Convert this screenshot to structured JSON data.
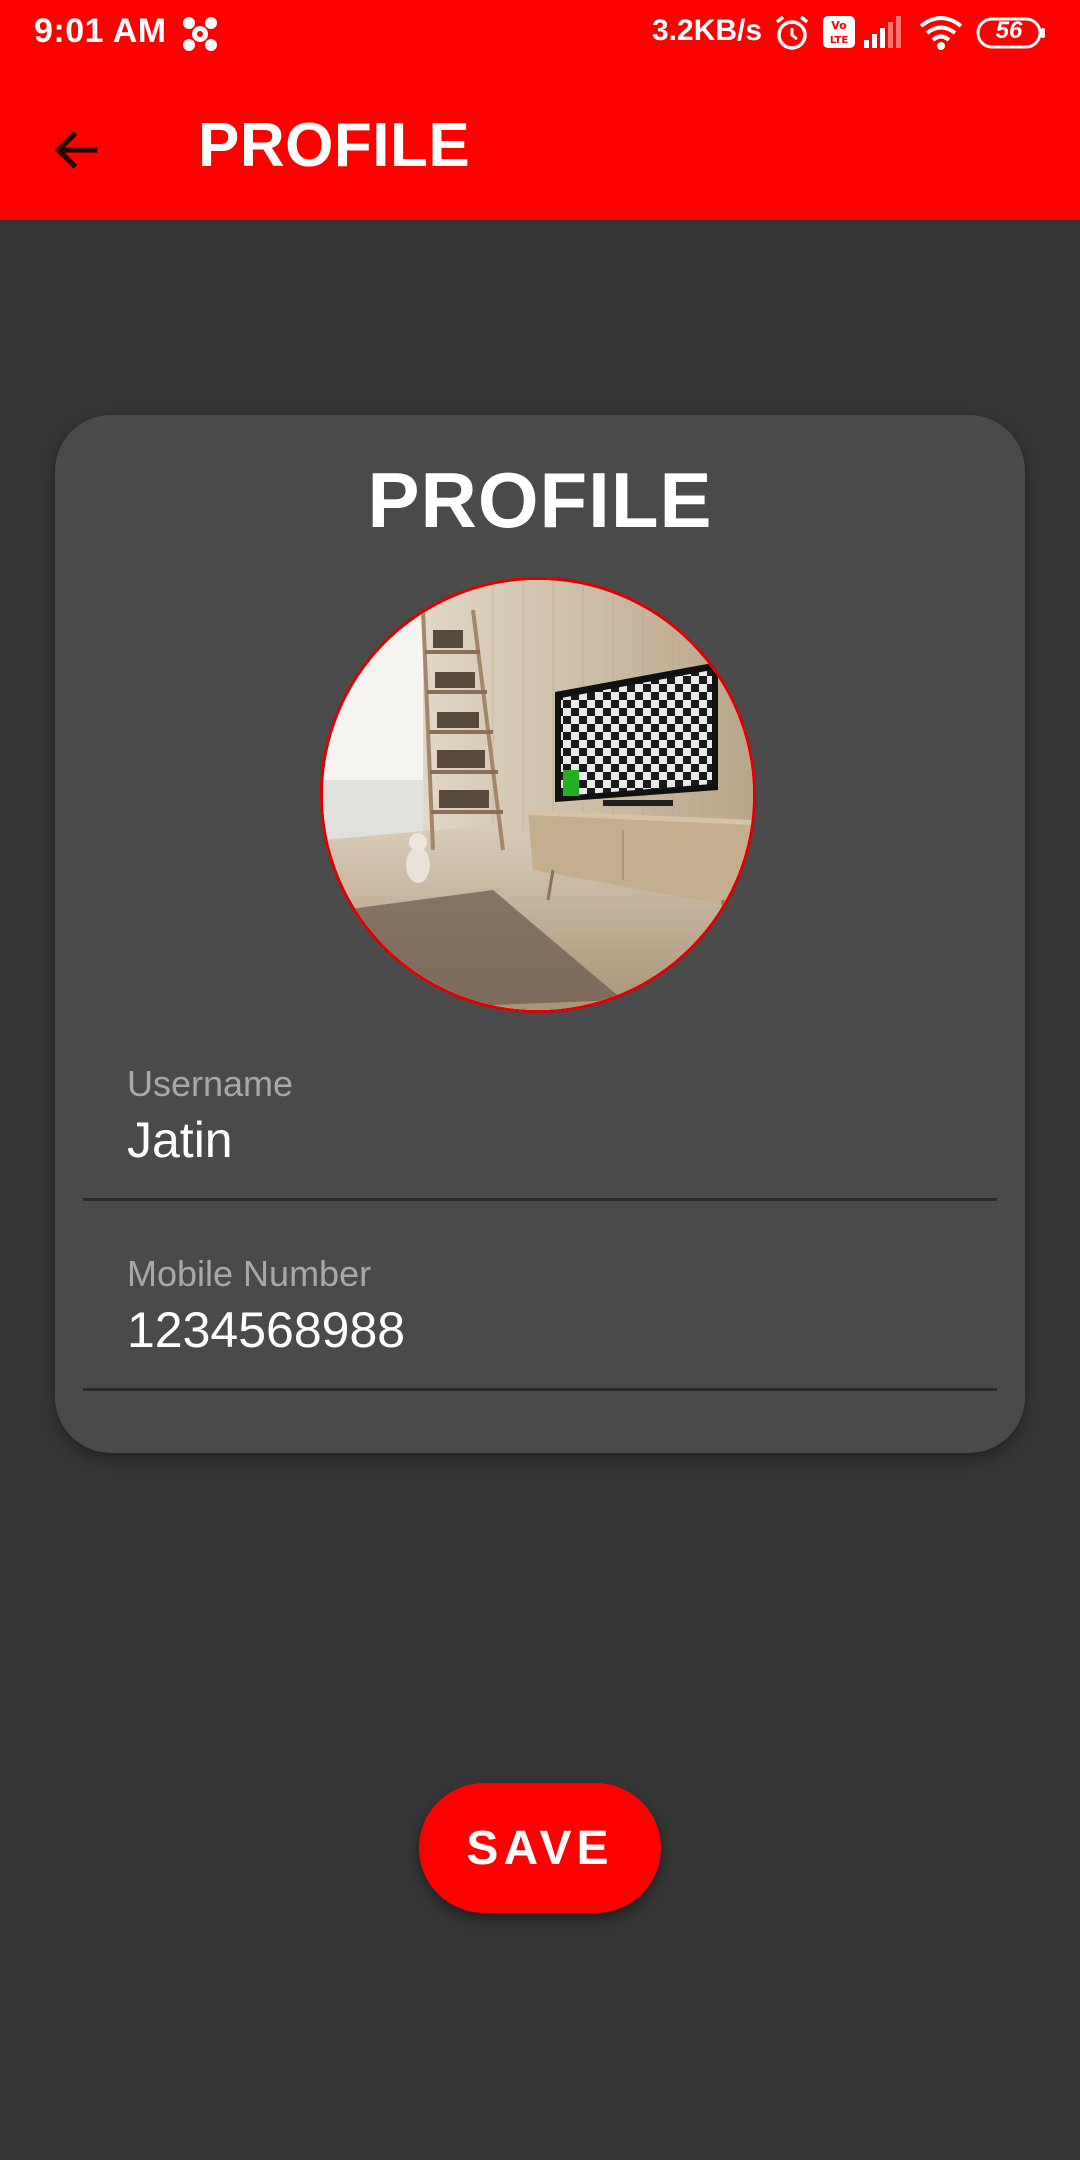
{
  "status_bar": {
    "time": "9:01 AM",
    "network_speed": "3.2KB/s",
    "battery_level": "56",
    "icons": [
      "app-notification-icon",
      "alarm-icon",
      "volte-icon",
      "signal-icon",
      "wifi-icon",
      "battery-icon"
    ]
  },
  "app_bar": {
    "title": "PROFILE",
    "back_icon": "arrow-left-icon"
  },
  "card": {
    "title": "PROFILE",
    "avatar": "profile-photo",
    "fields": [
      {
        "label": "Username",
        "value": "Jatin"
      },
      {
        "label": "Mobile Number",
        "value": "1234568988"
      }
    ]
  },
  "actions": {
    "save_label": "SAVE"
  },
  "colors": {
    "accent": "#ff0000",
    "background": "#353535",
    "card": "#4a4a4a",
    "label": "#a8a8a8",
    "text": "#ffffff"
  }
}
